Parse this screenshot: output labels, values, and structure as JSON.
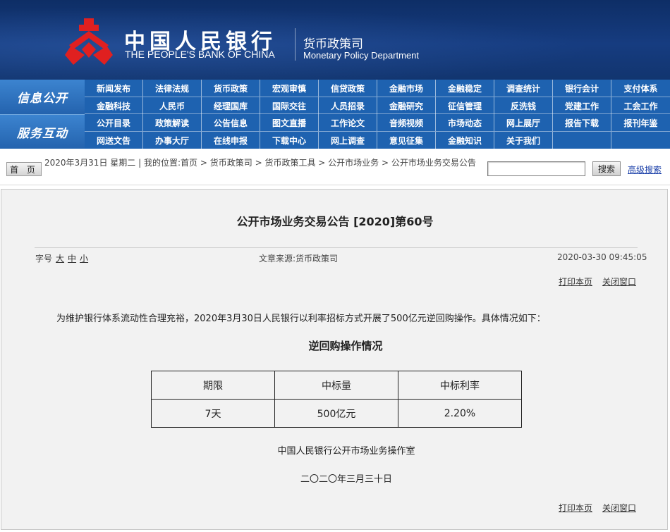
{
  "header": {
    "bank_cn": "中国人民银行",
    "bank_en": "THE PEOPLE'S BANK OF CHINA",
    "dept_cn": "货币政策司",
    "dept_en": "Monetary Policy Department",
    "logo_color": "#e02020"
  },
  "nav": {
    "section1_label": "信息公开",
    "section2_label": "服务互动",
    "rows": [
      [
        "新闻发布",
        "法律法规",
        "货币政策",
        "宏观审慎",
        "信贷政策",
        "金融市场",
        "金融稳定",
        "调查统计",
        "银行会计",
        "支付体系"
      ],
      [
        "金融科技",
        "人民币",
        "经理国库",
        "国际交往",
        "人员招录",
        "金融研究",
        "征信管理",
        "反洗钱",
        "党建工作",
        "工会工作"
      ],
      [
        "公开目录",
        "政策解读",
        "公告信息",
        "图文直播",
        "工作论文",
        "音频视频",
        "市场动态",
        "网上展厅",
        "报告下载",
        "报刊年鉴"
      ],
      [
        "网送文告",
        "办事大厅",
        "在线申报",
        "下载中心",
        "网上调查",
        "意见征集",
        "金融知识",
        "关于我们",
        "",
        ""
      ]
    ]
  },
  "crumbs": {
    "home_label": "首 页",
    "date_text": "2020年3月31日 星期二",
    "location_label": "我的位置:",
    "path": [
      "首页",
      "货币政策司",
      "货币政策工具",
      "公开市场业务",
      "公开市场业务交易公告"
    ],
    "search_button": "搜索",
    "advanced_search": "高级搜索",
    "search_value": ""
  },
  "article": {
    "title": "公开市场业务交易公告 [2020]第60号",
    "font_size_label": "字号",
    "font_sizes": [
      "大",
      "中",
      "小"
    ],
    "source": "文章来源:货币政策司",
    "datetime": "2020-03-30 09:45:05",
    "print_label": "打印本页",
    "close_label": "关闭窗口",
    "body": "为维护银行体系流动性合理充裕，2020年3月30日人民银行以利率招标方式开展了500亿元逆回购操作。具体情况如下：",
    "table_title": "逆回购操作情况",
    "table": {
      "headers": [
        "期限",
        "中标量",
        "中标利率"
      ],
      "rows": [
        [
          "7天",
          "500亿元",
          "2.20%"
        ]
      ]
    },
    "signature": "中国人民银行公开市场业务操作室",
    "sign_date": "二〇二〇年三月三十日"
  }
}
